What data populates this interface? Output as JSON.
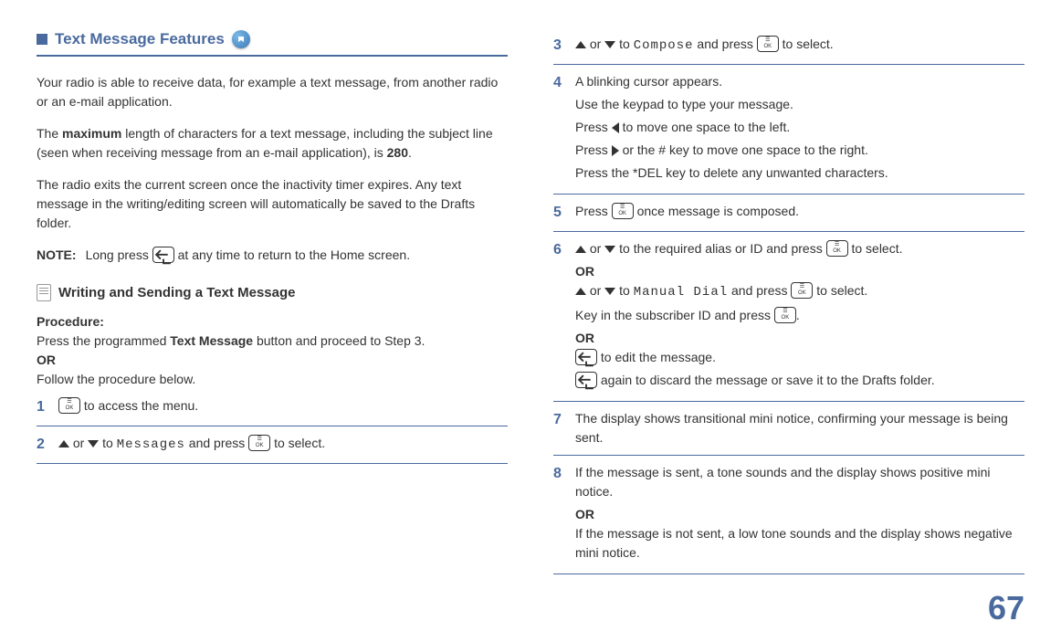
{
  "header": {
    "title": "Text Message Features"
  },
  "intro": {
    "p1": "Your radio is able to receive data, for example a text message, from another radio or an e-mail application.",
    "p2a": "The ",
    "p2b": "maximum",
    "p2c": " length of characters for a text message, including the subject line (seen when receiving message from an e-mail application), is ",
    "p2d": "280",
    "p2e": ".",
    "p3": "The radio exits the current screen once the inactivity timer expires. Any text message in the writing/editing screen will automatically be saved to the Drafts folder."
  },
  "note": {
    "label": "NOTE:",
    "text_a": "Long press ",
    "text_b": " at any time to return to the Home screen."
  },
  "subheader": {
    "title": "Writing and Sending a Text Message"
  },
  "procedure": {
    "label": "Procedure:",
    "line1a": "Press the programmed ",
    "line1b": "Text Message",
    "line1c": " button and proceed to Step 3.",
    "or": "OR",
    "line2": "Follow the procedure below."
  },
  "steps": {
    "s1": {
      "num": "1",
      "text": " to access the menu."
    },
    "s2": {
      "num": "2",
      "text_a": " or ",
      "text_b": " to ",
      "menu": "Messages",
      "text_c": " and press ",
      "text_d": " to select."
    },
    "s3": {
      "num": "3",
      "text_a": " or ",
      "text_b": " to ",
      "menu": "Compose",
      "text_c": " and press ",
      "text_d": " to select."
    },
    "s4": {
      "num": "4",
      "l1": "A blinking cursor appears.",
      "l2": "Use the keypad to type your message.",
      "l3a": "Press ",
      "l3b": " to move one space to the left.",
      "l4a": "Press ",
      "l4b": " or the # key to move one space to the right.",
      "l5": "Press the *DEL key to delete any unwanted characters."
    },
    "s5": {
      "num": "5",
      "text_a": "Press ",
      "text_b": " once message is composed."
    },
    "s6": {
      "num": "6",
      "l1a": " or ",
      "l1b": " to the required alias or ID and press ",
      "l1c": " to select.",
      "or": "OR",
      "l2a": " or ",
      "l2b": " to ",
      "menu": "Manual Dial",
      "l2c": " and press ",
      "l2d": " to select.",
      "l3a": "Key in the subscriber ID and press ",
      "l3b": ".",
      "l4": " to edit the message.",
      "l5": " again to discard the message or save it to the Drafts folder."
    },
    "s7": {
      "num": "7",
      "text": "The display shows  transitional mini notice, confirming your message is being sent."
    },
    "s8": {
      "num": "8",
      "l1": "If the message is sent, a tone sounds and the display shows positive mini notice.",
      "or": "OR",
      "l2": "If the message is not sent, a low tone sounds and the display shows negative mini notice."
    }
  },
  "page": "67"
}
